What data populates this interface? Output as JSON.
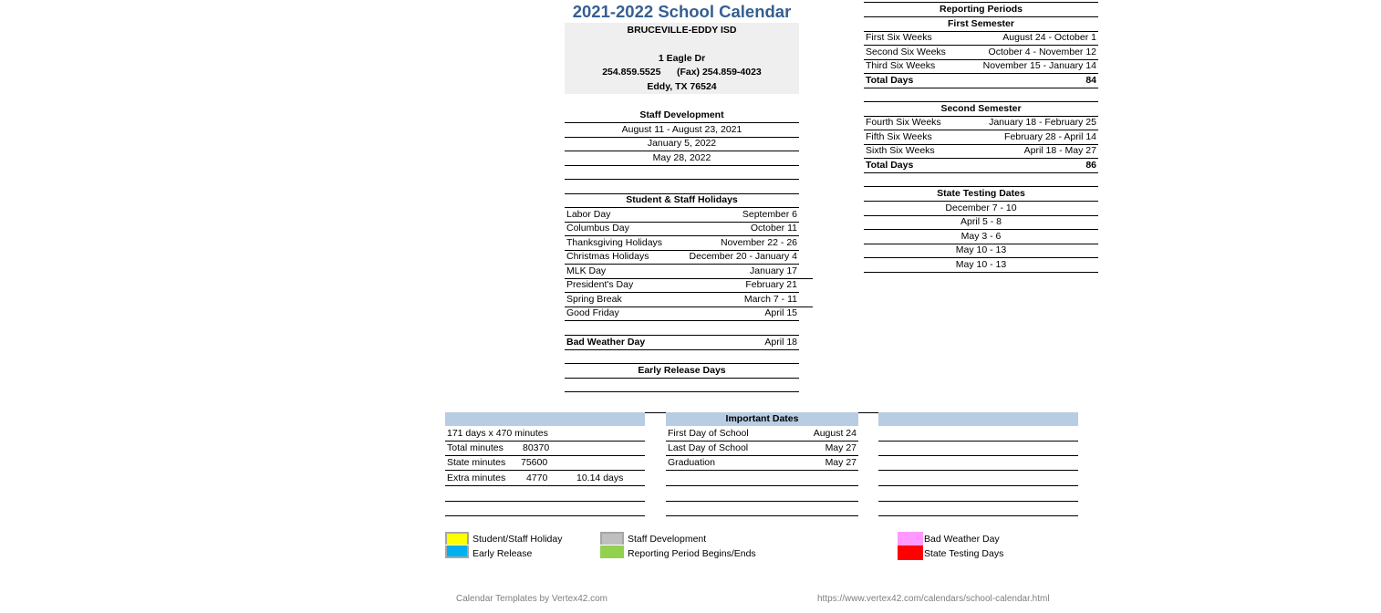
{
  "title": "2021-2022 School Calendar",
  "district": {
    "name": "BRUCEVILLE-EDDY ISD",
    "address": "1 Eagle Dr",
    "phone": "254.859.5525",
    "fax": "(Fax) 254.859-4023",
    "city": "Eddy, TX 76524"
  },
  "staff_development": {
    "heading": "Staff Development",
    "items": [
      "August 11 - August 23, 2021",
      "January 5, 2022",
      "May 28, 2022",
      "",
      ""
    ]
  },
  "holidays": {
    "heading": "Student & Staff Holidays",
    "items": [
      {
        "name": "Labor Day",
        "date": "September 6"
      },
      {
        "name": "Columbus Day",
        "date": "October 11"
      },
      {
        "name": "Thanksgiving Holidays",
        "date": "November 22 - 26"
      },
      {
        "name": "Christmas Holidays",
        "date": "December 20 - January 4"
      },
      {
        "name": "MLK Day",
        "date": "January 17"
      },
      {
        "name": "President's Day",
        "date": "February 21"
      },
      {
        "name": "Spring Break",
        "date": "March 7 - 11"
      },
      {
        "name": "Good Friday",
        "date": "April 15"
      }
    ]
  },
  "bad_weather": {
    "label": "Bad Weather Day",
    "date": "April 18"
  },
  "early_release": {
    "heading": "Early Release Days"
  },
  "reporting_periods": {
    "heading": "Reporting Periods",
    "first_semester": {
      "heading": "First Semester",
      "items": [
        {
          "name": "First Six Weeks",
          "range": "August 24 - October 1"
        },
        {
          "name": "Second Six Weeks",
          "range": "October 4 - November 12"
        },
        {
          "name": "Third Six Weeks",
          "range": "November 15 - January 14"
        }
      ],
      "total_label": "Total Days",
      "total": "84"
    },
    "second_semester": {
      "heading": "Second Semester",
      "items": [
        {
          "name": "Fourth Six Weeks",
          "range": "January 18 - February 25"
        },
        {
          "name": "Fifth Six Weeks",
          "range": "February 28 - April 14"
        },
        {
          "name": "Sixth Six Weeks",
          "range": "April 18 - May 27"
        }
      ],
      "total_label": "Total Days",
      "total": "86"
    }
  },
  "state_testing": {
    "heading": "State Testing Dates",
    "items": [
      "December 7 - 10",
      "April 5 - 8",
      "May 3 - 6",
      "May 10 - 13",
      "May 10 - 13"
    ]
  },
  "minutes": {
    "summary": "171 days x 470 minutes",
    "rows": [
      {
        "label": "Total minutes",
        "value": "80370",
        "extra": ""
      },
      {
        "label": "State minutes",
        "value": "75600",
        "extra": ""
      },
      {
        "label": "Extra minutes",
        "value": "4770",
        "extra": "10.14 days"
      }
    ]
  },
  "important_dates": {
    "heading": "Important Dates",
    "items": [
      {
        "name": "First Day of School",
        "date": "August 24"
      },
      {
        "name": "Last Day of School",
        "date": "May 27"
      },
      {
        "name": "Graduation",
        "date": "May 27"
      }
    ]
  },
  "legend": [
    {
      "label": "Student/Staff Holiday",
      "color": "#ffff00"
    },
    {
      "label": "Early Release",
      "color": "#00b0f0"
    },
    {
      "label": "Staff Development",
      "color": "#bfbfbf"
    },
    {
      "label": "Reporting Period Begins/Ends",
      "color": "#92d050"
    },
    {
      "label": "Bad Weather Day",
      "color": "#ff99ff"
    },
    {
      "label": "State Testing Days",
      "color": "#ff0000"
    }
  ],
  "footer": {
    "left": "Calendar Templates by Vertex42.com",
    "right": "https://www.vertex42.com/calendars/school-calendar.html"
  }
}
